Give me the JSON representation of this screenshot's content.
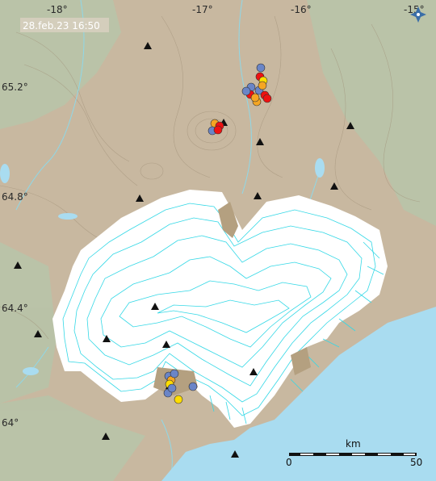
{
  "timestamp": "28.feb.23  16:50",
  "longitude_labels": [
    "-18°",
    "-17°",
    "-16°",
    "-15°"
  ],
  "latitude_labels": [
    "65.2°",
    "64.8°",
    "64.4°",
    "64°"
  ],
  "scale": {
    "unit": "km",
    "start": "0",
    "end": "50"
  },
  "colors": {
    "land": "#c8b8a0",
    "lowland": "#b8c4a8",
    "glacier": "#ffffff",
    "ice_contour": "#34d8e6",
    "sea": "#a9dcf0",
    "peak": "#111111",
    "quake_red": "#ee1111",
    "quake_orange": "#f5a623",
    "quake_yellow": "#ffdd00",
    "quake_blue": "#6a85c7"
  },
  "earthquake_clusters": [
    {
      "name": "askja",
      "events": [
        {
          "color": "quake_blue"
        },
        {
          "color": "quake_red"
        },
        {
          "color": "quake_yellow"
        },
        {
          "color": "quake_blue"
        },
        {
          "color": "quake_red"
        },
        {
          "color": "quake_orange"
        },
        {
          "color": "quake_blue"
        },
        {
          "color": "quake_red"
        },
        {
          "color": "quake_orange"
        },
        {
          "color": "quake_red"
        },
        {
          "color": "quake_blue"
        },
        {
          "color": "quake_orange"
        }
      ]
    },
    {
      "name": "herdubreid",
      "events": [
        {
          "color": "quake_orange"
        },
        {
          "color": "quake_red"
        },
        {
          "color": "quake_blue"
        },
        {
          "color": "quake_red"
        }
      ]
    },
    {
      "name": "myrdalsjokull-area",
      "events": [
        {
          "color": "quake_blue"
        },
        {
          "color": "quake_orange"
        },
        {
          "color": "quake_yellow"
        },
        {
          "color": "quake_blue"
        },
        {
          "color": "quake_blue"
        },
        {
          "color": "quake_blue"
        },
        {
          "color": "quake_yellow"
        },
        {
          "color": "quake_blue"
        }
      ]
    }
  ],
  "peak_count": 16
}
